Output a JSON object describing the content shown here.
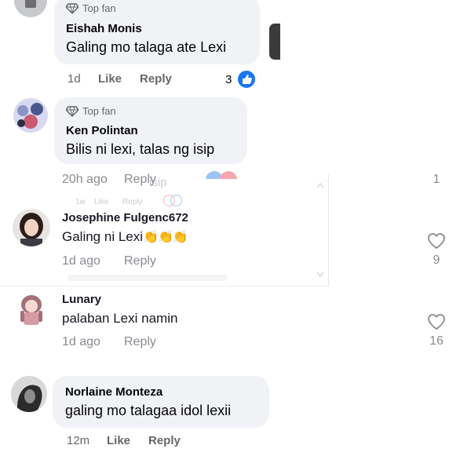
{
  "comments": [
    {
      "badge": "Top fan",
      "name": "Eishah Monis",
      "text": "Galing mo talaga ate Lexi",
      "time": "1d",
      "like": "Like",
      "reply": "Reply",
      "reactions": "3"
    },
    {
      "badge": "Top fan",
      "name": "Ken Polintan",
      "text": "Bilis ni lexi, talas ng isip",
      "time": "20h ago",
      "reply": "Reply",
      "count": "1"
    },
    {
      "name": "Josephine Fulgenc672",
      "text": "Galing ni Lexi",
      "emoji": "👏👏👏",
      "time": "1d ago",
      "reply": "Reply",
      "likes": "9"
    },
    {
      "name": "Lunary",
      "text": "palaban Lexi namin",
      "time": "1d ago",
      "reply": "Reply",
      "likes": "16"
    },
    {
      "name": "Norlaine Monteza",
      "text": "galing mo talagaa idol lexii",
      "time": "12m",
      "like": "Like",
      "reply": "Reply"
    }
  ],
  "overlay": {
    "ghost_time": "1w",
    "ghost_like": "Like",
    "ghost_reply": "Reply",
    "ghost_word": "isip"
  },
  "colors": {
    "facebook_blue": "#1877f2",
    "bubble": "#f0f2f5",
    "muted": "#65676b",
    "tiktok_muted": "#8a8b91"
  },
  "icons": [
    "top-fan-diamond-icon",
    "like-reaction-icon",
    "heart-outline-icon",
    "clap-emoji-icon"
  ]
}
